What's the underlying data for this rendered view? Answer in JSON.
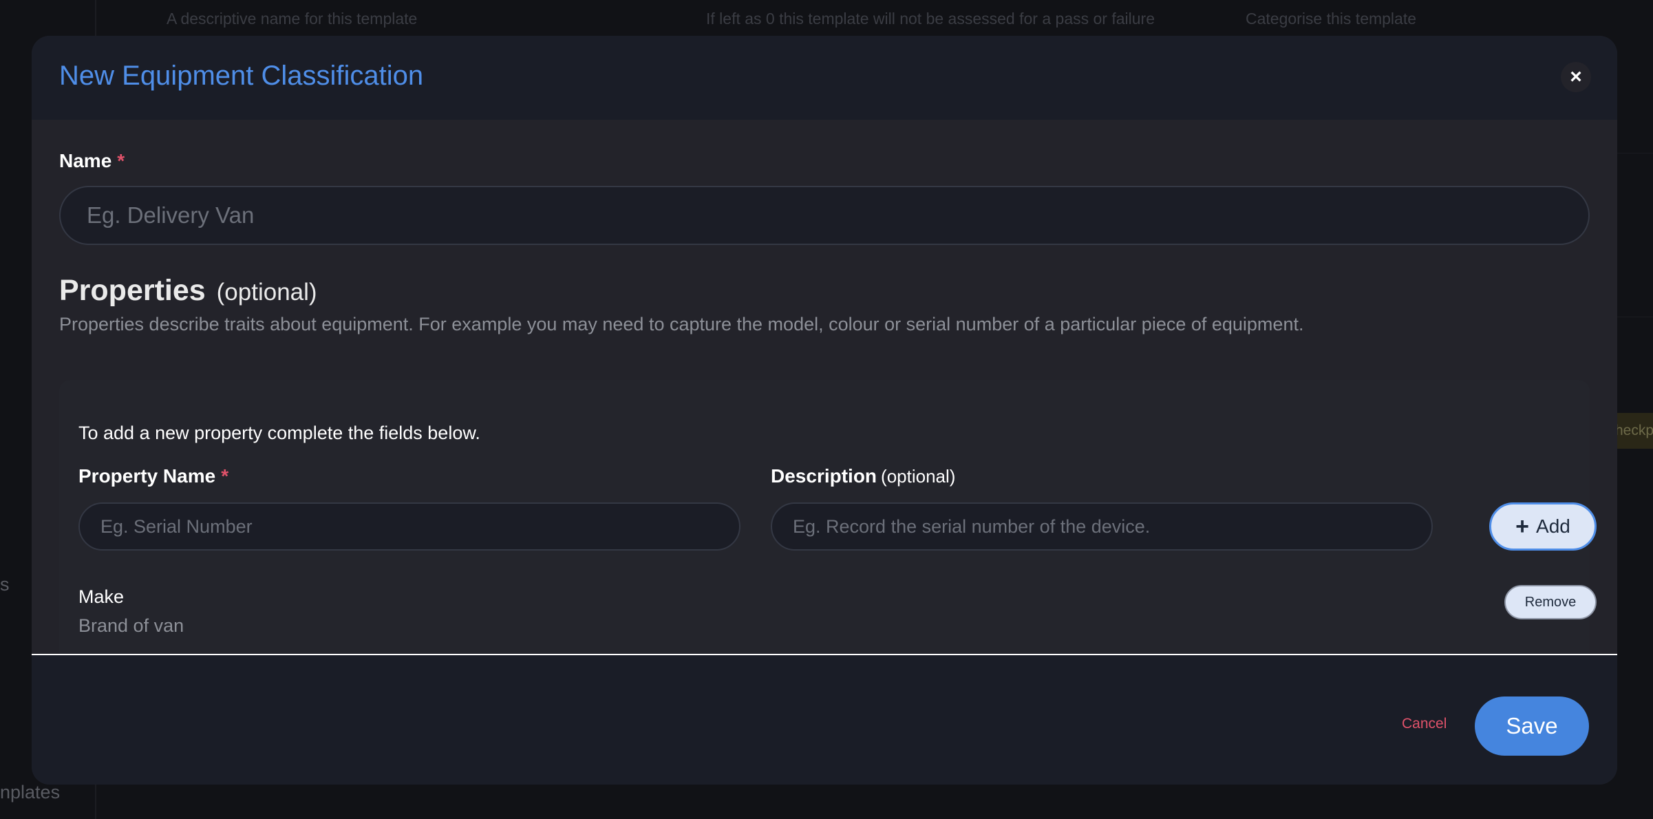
{
  "background": {
    "hints": [
      "A descriptive name for this template",
      "If left as 0 this template will not be assessed for a pass or failure",
      "Categorise this template"
    ],
    "sidebar_fragment_1": "s",
    "sidebar_fragment_2": "nplates",
    "right_badge_fragment": "heckp"
  },
  "modal": {
    "title": "New Equipment Classification",
    "close_label": "×",
    "name_field": {
      "label": "Name",
      "required_marker": "*",
      "placeholder": "Eg. Delivery Van",
      "value": ""
    },
    "properties": {
      "heading": "Properties",
      "heading_optional": "(optional)",
      "description": "Properties describe traits about equipment. For example you may need to capture the model, colour or serial number of a particular piece of equipment.",
      "intro": "To add a new property complete the fields below.",
      "property_name": {
        "label": "Property Name",
        "required_marker": "*",
        "placeholder": "Eg. Serial Number",
        "value": ""
      },
      "description_field": {
        "label": "Description",
        "optional": "(optional)",
        "placeholder": "Eg. Record the serial number of the device.",
        "value": ""
      },
      "add_button": {
        "icon": "plus-icon",
        "icon_glyph": "+",
        "label": "Add"
      },
      "items": [
        {
          "name": "Make",
          "description": "Brand of van",
          "remove_label": "Remove"
        }
      ]
    },
    "footer": {
      "cancel_label": "Cancel",
      "save_label": "Save"
    }
  },
  "colors": {
    "accent": "#4f8ee8",
    "danger": "#e0526a",
    "modal_bg": "#23232a",
    "header_bg": "#1a1d27"
  }
}
